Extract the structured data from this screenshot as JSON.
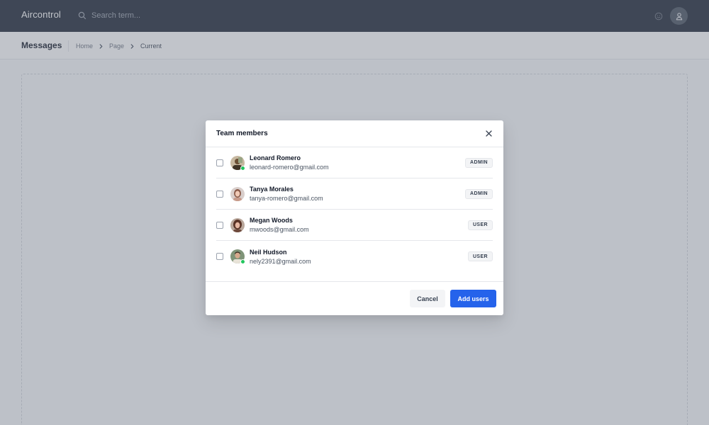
{
  "app": {
    "brand": "Aircontrol"
  },
  "search": {
    "placeholder": "Search term..."
  },
  "header": {
    "page_title": "Messages",
    "breadcrumb": [
      "Home",
      "Page",
      "Current"
    ]
  },
  "icons": {
    "search": "search-icon",
    "smile": "smile-icon",
    "user": "user-icon",
    "chevron": "chevron-right-icon",
    "close": "close-icon"
  },
  "modal": {
    "title": "Team members",
    "members": [
      {
        "name": "Leonard Romero",
        "email": "leonard-romero@gmail.com",
        "role": "ADMIN",
        "online": true
      },
      {
        "name": "Tanya Morales",
        "email": "tanya-romero@gmail.com",
        "role": "ADMIN",
        "online": false
      },
      {
        "name": "Megan Woods",
        "email": "mwoods@gmail.com",
        "role": "USER",
        "online": false
      },
      {
        "name": "Neil Hudson",
        "email": "nely2391@gmail.com",
        "role": "USER",
        "online": true
      }
    ],
    "cancel_label": "Cancel",
    "submit_label": "Add users"
  },
  "colors": {
    "navbar": "#1f2937",
    "primary": "#2563eb",
    "online": "#22c55e"
  }
}
